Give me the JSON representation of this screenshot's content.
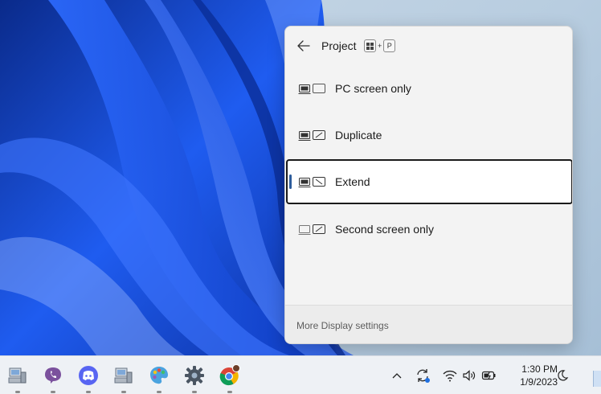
{
  "flyout": {
    "title": "Project",
    "shortcut": {
      "key1_icon": "windows-key-icon",
      "plus": "+",
      "key2": "P"
    },
    "options": [
      {
        "label": "PC screen only",
        "icon": "pc-screen-only-icon",
        "selected": false
      },
      {
        "label": "Duplicate",
        "icon": "duplicate-icon",
        "selected": false
      },
      {
        "label": "Extend",
        "icon": "extend-icon",
        "selected": true
      },
      {
        "label": "Second screen only",
        "icon": "second-screen-only-icon",
        "selected": false
      }
    ],
    "footer_link": "More Display settings"
  },
  "taskbar": {
    "apps": [
      "computer-icon",
      "viber-icon",
      "discord-icon",
      "computer-icon",
      "paint-icon",
      "settings-gear-icon",
      "chrome-icon"
    ],
    "tray": [
      "chevron-up-icon",
      "sync-icon",
      "wifi-icon",
      "volume-icon",
      "battery-icon"
    ],
    "time": "1:30 PM",
    "date": "1/9/2023"
  },
  "colors": {
    "wallpaper_blue": "#1f5cf0",
    "flyout_bg": "#f3f3f3",
    "selected_border": "#1a1a1a",
    "indicator": "#2e5d9c"
  }
}
